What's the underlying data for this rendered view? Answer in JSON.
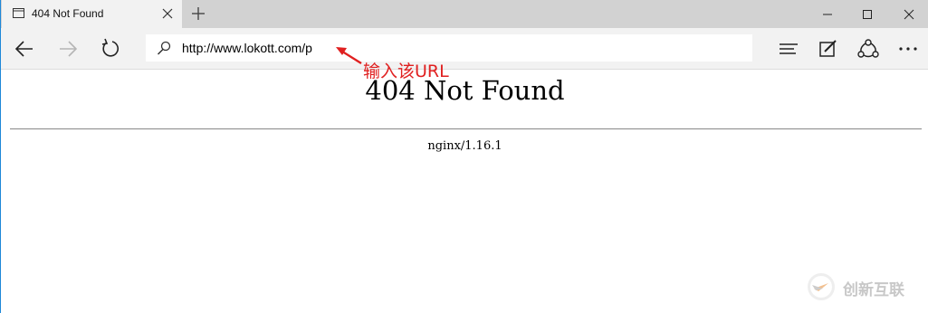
{
  "tab": {
    "title": "404 Not Found"
  },
  "address_bar": {
    "url": "http://www.lokott.com/p"
  },
  "page": {
    "heading": "404 Not Found",
    "server": "nginx/1.16.1"
  },
  "annotation": {
    "text": "输入该URL",
    "color": "#e02020"
  },
  "watermark": {
    "text": "创新互联"
  },
  "icons": {
    "tab": "page-icon",
    "close_tab": "close-icon",
    "new_tab": "plus-icon",
    "minimize": "minimize-icon",
    "maximize": "maximize-icon",
    "close_window": "close-icon",
    "back": "back-arrow-icon",
    "forward": "forward-arrow-icon",
    "refresh": "refresh-icon",
    "search": "search-icon",
    "hub": "hub-icon",
    "notes": "web-note-icon",
    "share": "share-icon",
    "more": "more-icon"
  }
}
